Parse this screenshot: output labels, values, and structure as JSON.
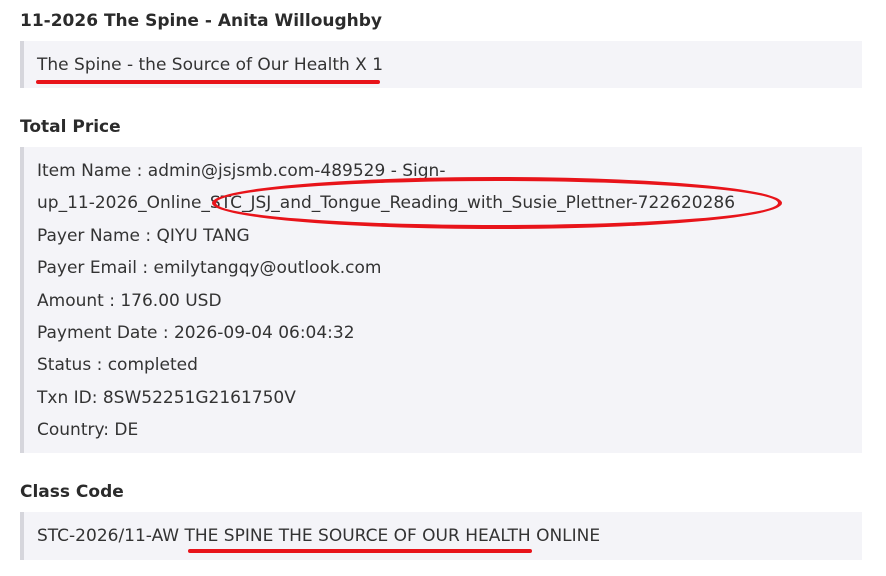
{
  "product": {
    "heading": "11-2026 The Spine - Anita Willoughby",
    "item_text": "The Spine - the Source of Our Health X 1"
  },
  "total_price": {
    "heading": "Total Price",
    "lines": [
      "Item Name : admin@jsjsmb.com-489529 - Sign-",
      "up_11-2026_Online_STC_JSJ_and_Tongue_Reading_with_Susie_Plettner-722620286",
      "Payer Name : QIYU TANG",
      "Payer Email : emilytangqy@outlook.com",
      "Amount : 176.00 USD",
      "Payment Date : 2026-09-04 06:04:32",
      "Status : completed",
      "Txn ID: 8SW52251G2161750V",
      "Country: DE"
    ]
  },
  "class_code": {
    "heading": "Class Code",
    "value": "STC-2026/11-AW THE SPINE THE SOURCE OF OUR HEALTH ONLINE"
  },
  "annotation_color": "#e8141a"
}
